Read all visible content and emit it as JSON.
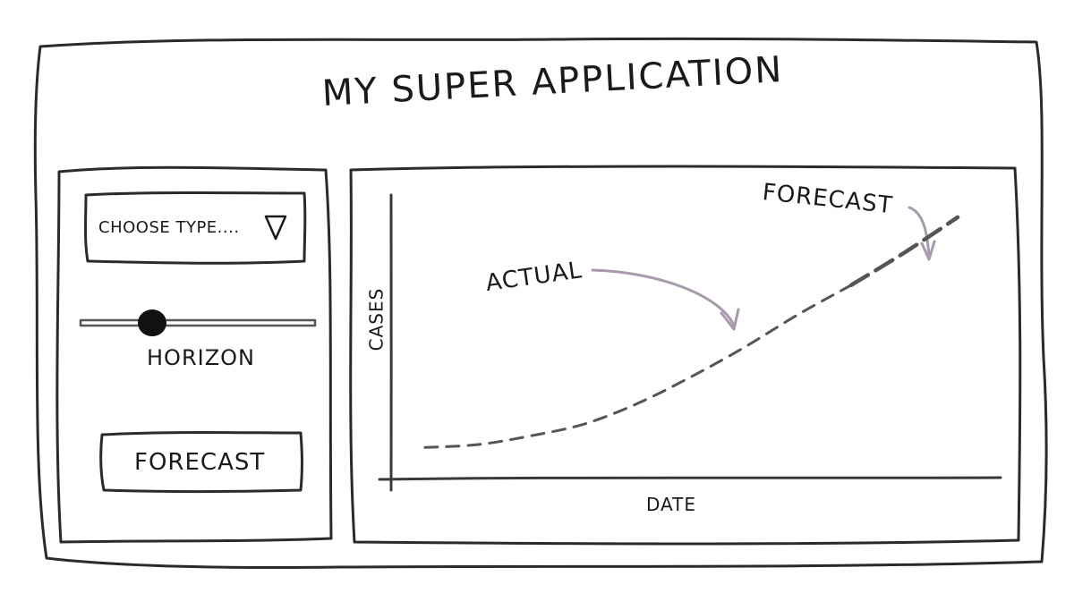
{
  "app": {
    "title": "MY SUPER APPLICATION"
  },
  "controls": {
    "type_select": {
      "selected": "CHOOSE TYPE....",
      "icon": "triangle-down-icon"
    },
    "horizon_slider": {
      "label": "HORIZON",
      "value_fraction": 0.28
    },
    "forecast_button": {
      "label": "FORECAST"
    }
  },
  "chart": {
    "annotation_actual": "ACTUAL",
    "annotation_forecast": "FORECAST",
    "colors": {
      "line": "#555555",
      "annotation_arrow": "#a89aac",
      "frame": "#2a2a2a"
    }
  },
  "chart_data": {
    "type": "line",
    "title": "",
    "xlabel": "DATE",
    "ylabel": "CASES",
    "grid": false,
    "series": [
      {
        "name": "ACTUAL",
        "style": "dashed",
        "x": [
          0.0,
          0.1,
          0.2,
          0.3,
          0.4,
          0.5,
          0.6,
          0.7,
          0.8
        ],
        "y": [
          0.09,
          0.1,
          0.13,
          0.17,
          0.24,
          0.33,
          0.43,
          0.54,
          0.64
        ]
      },
      {
        "name": "FORECAST",
        "style": "dashed-bold",
        "x": [
          0.8,
          0.9,
          1.0
        ],
        "y": [
          0.64,
          0.75,
          0.87
        ]
      }
    ]
  }
}
